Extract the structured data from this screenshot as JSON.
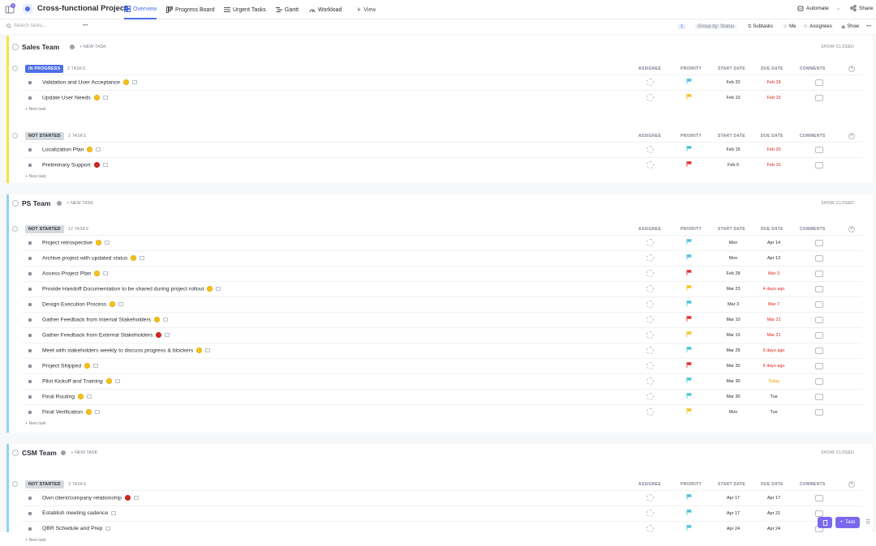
{
  "header": {
    "project_title": "Cross-functional Project",
    "notification_count": "4",
    "tabs": [
      {
        "label": "Overview",
        "active": true,
        "icon": "grid-icon"
      },
      {
        "label": "Progress Board",
        "active": false,
        "icon": "board-icon"
      },
      {
        "label": "Urgent Tasks",
        "active": false,
        "icon": "list-icon"
      },
      {
        "label": "Gantt",
        "active": false,
        "icon": "gantt-icon"
      },
      {
        "label": "Workload",
        "active": false,
        "icon": "workload-icon"
      }
    ],
    "view_label": "View",
    "automate_label": "Automate",
    "share_label": "Share"
  },
  "toolbar": {
    "search_placeholder": "Search tasks...",
    "filter_count": "1",
    "group_by_label": "Group by:",
    "group_by_value": "Status",
    "subtasks_label": "Subtasks",
    "me_label": "Me",
    "assignees_label": "Assignees",
    "show_label": "Show"
  },
  "columns": {
    "assignee": "ASSIGNEE",
    "priority": "PRIORITY",
    "start_date": "START DATE",
    "due_date": "DUE DATE",
    "comments": "COMMENTS"
  },
  "colors": {
    "accent": "#4c6fe7",
    "sales_team": "#f8e23b",
    "ps_team": "#8bd4f7",
    "csm_team": "#8bd4f7",
    "flag_cyan": "#47c4d9",
    "flag_yellow": "#f8c21b",
    "flag_red": "#e02d2d",
    "overdue": "#d9251d",
    "today": "#e8a300"
  },
  "groups": [
    {
      "name": "Sales Team",
      "new_task_label": "+ NEW TASK",
      "show_closed_label": "SHOW CLOSED",
      "statuses": [
        {
          "label": "IN PROGRESS",
          "kind": "progress",
          "count": "2 TASKS",
          "new_task_label": "+ New task",
          "tasks": [
            {
              "name": "Validation and User Acceptance",
              "emoji": "y",
              "flag": "cyan",
              "start": "Feb 20",
              "due": "Feb 28",
              "due_color": "red"
            },
            {
              "name": "Update User Needs",
              "emoji": "y",
              "flag": "yellow",
              "start": "Feb 10",
              "due": "Feb 15",
              "due_color": "red"
            }
          ]
        },
        {
          "label": "NOT STARTED",
          "kind": "notstarted",
          "count": "2 TASKS",
          "new_task_label": "+ New task",
          "tasks": [
            {
              "name": "Localization Plan",
              "emoji": "y",
              "flag": "cyan",
              "start": "Feb 15",
              "due": "Feb 20",
              "due_color": "red"
            },
            {
              "name": "Preliminary Support",
              "emoji": "r",
              "flag": "red",
              "start": "Feb 6",
              "due": "Feb 10",
              "due_color": "red"
            }
          ]
        }
      ]
    },
    {
      "name": "PS Team",
      "new_task_label": "+ NEW TASK",
      "show_closed_label": "SHOW CLOSED",
      "statuses": [
        {
          "label": "NOT STARTED",
          "kind": "notstarted",
          "count": "12 TASKS",
          "new_task_label": "+ New task",
          "tasks": [
            {
              "name": "Project retrospective",
              "emoji": "y",
              "flag": "cyan",
              "start": "Mon",
              "due": "Apr 14",
              "due_color": "normal"
            },
            {
              "name": "Archive project with updated status",
              "emoji": "y",
              "flag": "cyan",
              "start": "Mon",
              "due": "Apr 13",
              "due_color": "normal"
            },
            {
              "name": "Assess Project Plan",
              "emoji": "y",
              "flag": "red",
              "start": "Feb 28",
              "due": "Mar 3",
              "due_color": "red"
            },
            {
              "name": "Provide Handoff Documentation to be shared during project rollout",
              "emoji": "y",
              "flag": "yellow",
              "start": "Mar 23",
              "due": "4 days ago",
              "due_color": "red"
            },
            {
              "name": "Design Execution Process",
              "emoji": "y",
              "flag": "cyan",
              "start": "Mar 3",
              "due": "Mar 7",
              "due_color": "red"
            },
            {
              "name": "Gather Feedback from Internal Stakeholders",
              "emoji": "y",
              "flag": "red",
              "start": "Mar 10",
              "due": "Mar 21",
              "due_color": "red"
            },
            {
              "name": "Gather Feedback from External Stakeholders",
              "emoji": "r",
              "flag": "yellow",
              "start": "Mar 10",
              "due": "Mar 21",
              "due_color": "red"
            },
            {
              "name": "Meet with stakeholders weekly to discuss progress & blockers",
              "emoji": "y",
              "flag": "cyan",
              "start": "Mar 29",
              "due": "5 days ago",
              "due_color": "red"
            },
            {
              "name": "Project Shipped",
              "emoji": "y",
              "flag": "red",
              "start": "Mar 30",
              "due": "6 days ago",
              "due_color": "red"
            },
            {
              "name": "Pilot Kickoff and Training",
              "emoji": "y",
              "flag": "cyan",
              "start": "Mar 30",
              "due": "Today",
              "due_color": "today"
            },
            {
              "name": "Final Routing",
              "emoji": "y",
              "flag": "cyan",
              "start": "Mar 30",
              "due": "Tue",
              "due_color": "normal"
            },
            {
              "name": "Final Verification",
              "emoji": "y",
              "flag": "yellow",
              "start": "Mon",
              "due": "Tue",
              "due_color": "normal"
            }
          ]
        }
      ]
    },
    {
      "name": "CSM Team",
      "new_task_label": "+ NEW TASK",
      "show_closed_label": "SHOW CLOSED",
      "statuses": [
        {
          "label": "NOT STARTED",
          "kind": "notstarted",
          "count": "3 TASKS",
          "new_task_label": "+ New task",
          "tasks": [
            {
              "name": "Own client/company relationship",
              "emoji": "r",
              "flag": "cyan",
              "start": "Apr 17",
              "due": "Apr 17",
              "due_color": "normal"
            },
            {
              "name": "Establish meeting cadence",
              "emoji": "",
              "flag": "cyan",
              "start": "Apr 17",
              "due": "Apr 21",
              "due_color": "normal"
            },
            {
              "name": "QBR Schedule and Prep",
              "emoji": "",
              "flag": "cyan",
              "start": "Apr 24",
              "due": "Apr 24",
              "due_color": "normal"
            }
          ]
        }
      ]
    }
  ],
  "fab": {
    "task_label": "Task"
  }
}
